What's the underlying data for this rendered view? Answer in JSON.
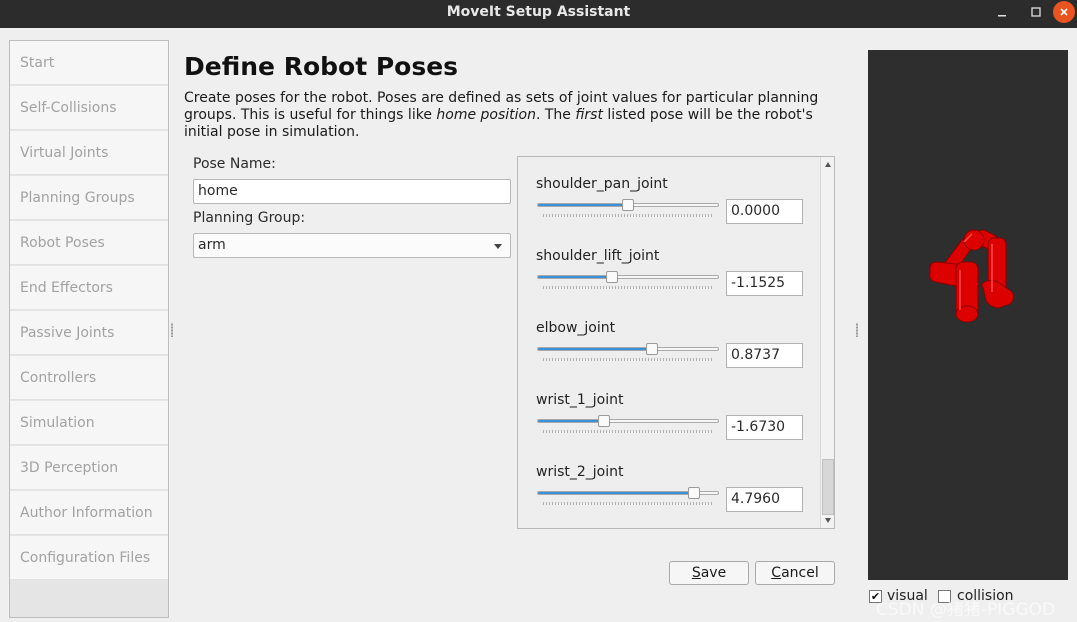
{
  "window": {
    "title": "MoveIt Setup Assistant"
  },
  "sidebar": {
    "items": [
      {
        "label": "Start"
      },
      {
        "label": "Self-Collisions"
      },
      {
        "label": "Virtual Joints"
      },
      {
        "label": "Planning Groups"
      },
      {
        "label": "Robot Poses"
      },
      {
        "label": "End Effectors"
      },
      {
        "label": "Passive Joints"
      },
      {
        "label": "Controllers"
      },
      {
        "label": "Simulation"
      },
      {
        "label": "3D Perception"
      },
      {
        "label": "Author Information"
      },
      {
        "label": "Configuration Files"
      }
    ]
  },
  "main": {
    "title": "Define Robot Poses",
    "description": {
      "part1": "Create poses for the robot. Poses are defined as sets of joint values for particular planning groups. This is useful for things like ",
      "em1": "home position",
      "part2": ". The ",
      "em2": "first",
      "part3": " listed pose will be the robot's initial pose in simulation."
    },
    "pose_name_label": "Pose Name:",
    "pose_name_value": "home",
    "planning_group_label": "Planning Group:",
    "planning_group_value": "arm",
    "joints": [
      {
        "name": "shoulder_pan_joint",
        "value": "0.0000",
        "slider_fraction": 0.5
      },
      {
        "name": "shoulder_lift_joint",
        "value": "-1.1525",
        "slider_fraction": 0.41
      },
      {
        "name": "elbow_joint",
        "value": "0.8737",
        "slider_fraction": 0.63
      },
      {
        "name": "wrist_1_joint",
        "value": "-1.6730",
        "slider_fraction": 0.37
      },
      {
        "name": "wrist_2_joint",
        "value": "4.7960",
        "slider_fraction": 0.86
      }
    ],
    "save_button": {
      "mnemonic": "S",
      "rest": "ave"
    },
    "cancel_button": {
      "mnemonic": "C",
      "rest": "ancel"
    }
  },
  "viewer": {
    "visual_label": "visual",
    "visual_checked": true,
    "collision_label": "collision",
    "collision_checked": false,
    "robot_color": "#dd0000"
  },
  "watermark": "CSDN @猪猪-PIGGOD",
  "colors": {
    "accent": "#3a8fd6",
    "titlebar": "#2c2c2c",
    "close": "#e95420"
  }
}
